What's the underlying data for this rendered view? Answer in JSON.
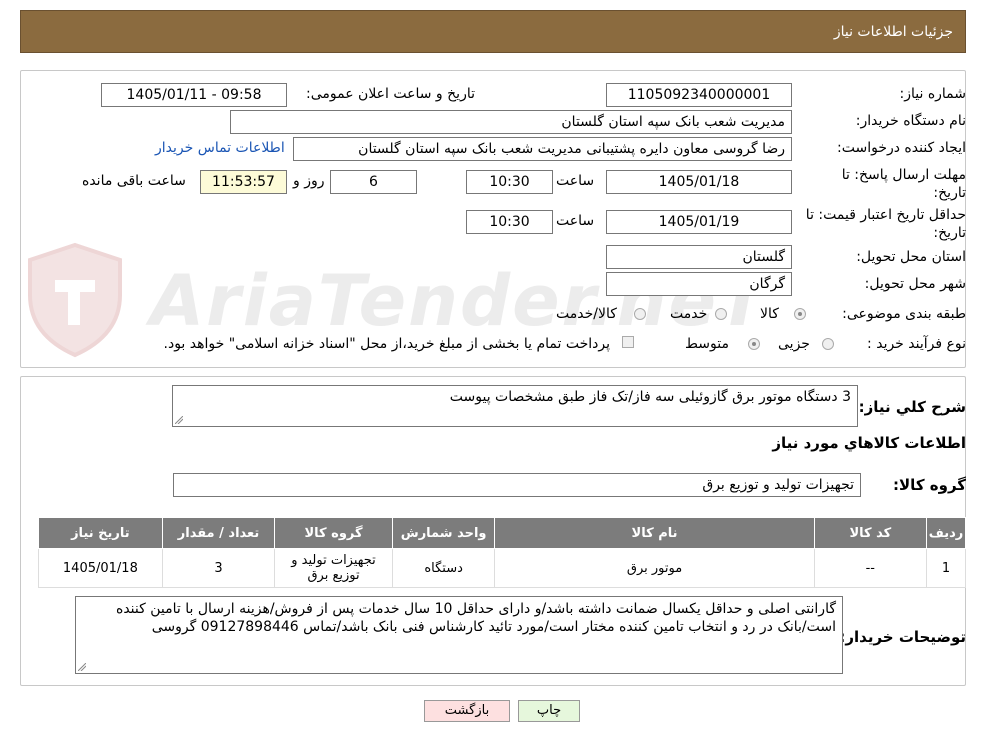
{
  "header": {
    "title": "جزئیات اطلاعات نیاز"
  },
  "watermark": {
    "text": "AriaTender.neT"
  },
  "form": {
    "need_number": {
      "label": "شماره نیاز:",
      "value": "1105092340000001"
    },
    "announce": {
      "label": "تاریخ و ساعت اعلان عمومی:",
      "value": "1405/01/11 - 09:58"
    },
    "buyer_org": {
      "label": "نام دستگاه خریدار:",
      "value": "مدیریت شعب بانک سپه استان گلستان"
    },
    "requester": {
      "label": "ایجاد کننده درخواست:",
      "value": "رضا گروسی معاون دایره پشتیبانی مدیریت شعب بانک سپه استان گلستان",
      "contact_link": "اطلاعات تماس خریدار"
    },
    "deadline": {
      "label_line1": "مهلت ارسال پاسخ: تا",
      "label_line2": "تاریخ:",
      "date": "1405/01/18",
      "time_label": "ساعت",
      "time": "10:30",
      "days": "6",
      "days_label": "روز و",
      "remaining": "11:53:57",
      "remaining_label": "ساعت باقی مانده"
    },
    "validity": {
      "label_line1": "حداقل تاریخ اعتبار قیمت: تا",
      "label_line2": "تاریخ:",
      "date": "1405/01/19",
      "time_label": "ساعت",
      "time": "10:30"
    },
    "province": {
      "label": "استان محل تحویل:",
      "value": "گلستان"
    },
    "city": {
      "label": "شهر محل تحویل:",
      "value": "گرگان"
    },
    "category": {
      "label": "طبقه بندی موضوعی:",
      "options": [
        "کالا",
        "خدمت",
        "کالا/خدمت"
      ],
      "selected": "کالا"
    },
    "process": {
      "label": "نوع فرآیند خرید :",
      "options": [
        "جزیی",
        "متوسط"
      ],
      "selected": "متوسط",
      "note": "پرداخت تمام یا بخشی از مبلغ خرید،از محل \"اسناد خزانه اسلامی\" خواهد بود."
    }
  },
  "summary": {
    "label": "شرح کلي نياز:",
    "value": "3 دستگاه موتور برق گازوئیلی سه فاز/تک فاز طبق مشخصات پیوست",
    "goods_title": "اطلاعات کالاهاي مورد نياز",
    "group_label": "گروه کالا:",
    "group_value": "تجهیزات تولید و توزیع برق"
  },
  "table": {
    "headers": [
      "ردیف",
      "کد کالا",
      "نام کالا",
      "واحد شمارش",
      "گروه کالا",
      "تعداد / مقدار",
      "تاریخ نیاز"
    ],
    "rows": [
      [
        "1",
        "--",
        "موتور برق",
        "دستگاه",
        "تجهیزات تولید و توزیع برق",
        "3",
        "1405/01/18"
      ]
    ]
  },
  "buyer_notes": {
    "label": "توضیحات خریدار:",
    "value": "گارانتی اصلی و حداقل یکسال ضمانت داشته باشد/و دارای حداقل 10 سال خدمات پس از فروش/هزینه ارسال با تامین کننده است/بانک در رد و انتخاب تامین کننده مختار است/مورد تائید کارشناس فنی بانک باشد/تماس 09127898446 گروسی"
  },
  "buttons": {
    "print": "چاپ",
    "back": "بازگشت"
  },
  "colors": {
    "header_bg": "#8b6b3f",
    "table_header": "#7c7c7c",
    "link": "#1a55b4",
    "remaining_bg": "#fdfbd8",
    "back_btn": "#fde0e0",
    "print_btn": "#e6f7dc"
  }
}
